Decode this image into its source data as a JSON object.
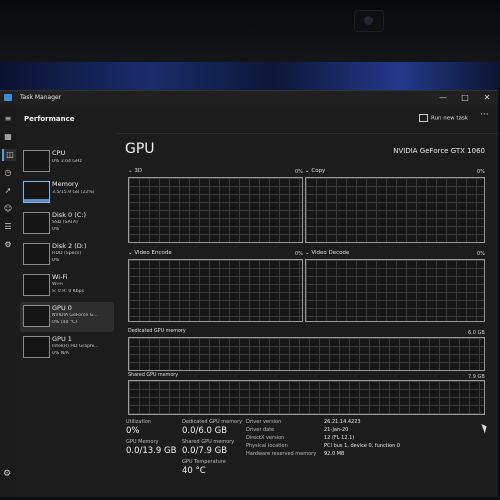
{
  "window": {
    "title": "Task Manager",
    "controls": {
      "minimize": "—",
      "maximize": "□",
      "close": "✕"
    },
    "section": "Performance",
    "run_new_task": "Run new task",
    "more": "···"
  },
  "rail_icons": [
    "hamburger-icon",
    "processes-icon",
    "performance-icon",
    "app-history-icon",
    "startup-apps-icon",
    "users-icon",
    "details-icon",
    "services-icon"
  ],
  "sidebar": [
    {
      "title": "CPU",
      "sub1": "0% 3.64 GHz",
      "sub2": ""
    },
    {
      "title": "Memory",
      "sub1": "3.5/15.9 GB (22%)",
      "sub2": ""
    },
    {
      "title": "Disk 0 (C:)",
      "sub1": "SSD (SATA)",
      "sub2": "0%"
    },
    {
      "title": "Disk 2 (D:)",
      "sub1": "HDD (Specs)",
      "sub2": "0%"
    },
    {
      "title": "Wi-Fi",
      "sub1": "Wi-Fi",
      "sub2": "S: 0 R: 0 Kbps"
    },
    {
      "title": "GPU 0",
      "sub1": "NVIDIA GeForce G...",
      "sub2": "0% (40 °C)"
    },
    {
      "title": "GPU 1",
      "sub1": "Intel(R) HD Graphi...",
      "sub2": "0% N/A"
    }
  ],
  "gpu": {
    "title": "GPU",
    "name": "NVIDIA GeForce GTX 1060",
    "engines": [
      {
        "label": "3D",
        "pct": "0%"
      },
      {
        "label": "Copy",
        "pct": "0%"
      },
      {
        "label": "Video Encode",
        "pct": "0%"
      },
      {
        "label": "Video Decode",
        "pct": "0%"
      }
    ],
    "dedicated_label": "Dedicated GPU memory",
    "dedicated_max": "6.0 GB",
    "shared_label": "Shared GPU memory",
    "shared_max": "7.9 GB"
  },
  "stats": {
    "utilization_label": "Utilization",
    "utilization": "0%",
    "dedicated_label": "Dedicated GPU memory",
    "dedicated": "0.0/6.0 GB",
    "gpu_memory_label": "GPU Memory",
    "gpu_memory": "0.0/13.9 GB",
    "shared_label": "Shared GPU memory",
    "shared": "0.0/7.9 GB",
    "temp_label": "GPU Temperature",
    "temp": "40 °C"
  },
  "details": [
    {
      "label": "Driver version",
      "value": "26.21.14.4223"
    },
    {
      "label": "Driver date",
      "value": "21-Jan-20"
    },
    {
      "label": "DirectX version",
      "value": "12 (FL 12.1)"
    },
    {
      "label": "Physical location",
      "value": "PCI bus 1, device 0, function 0"
    },
    {
      "label": "Hardware reserved memory",
      "value": "92.0 MB"
    }
  ]
}
